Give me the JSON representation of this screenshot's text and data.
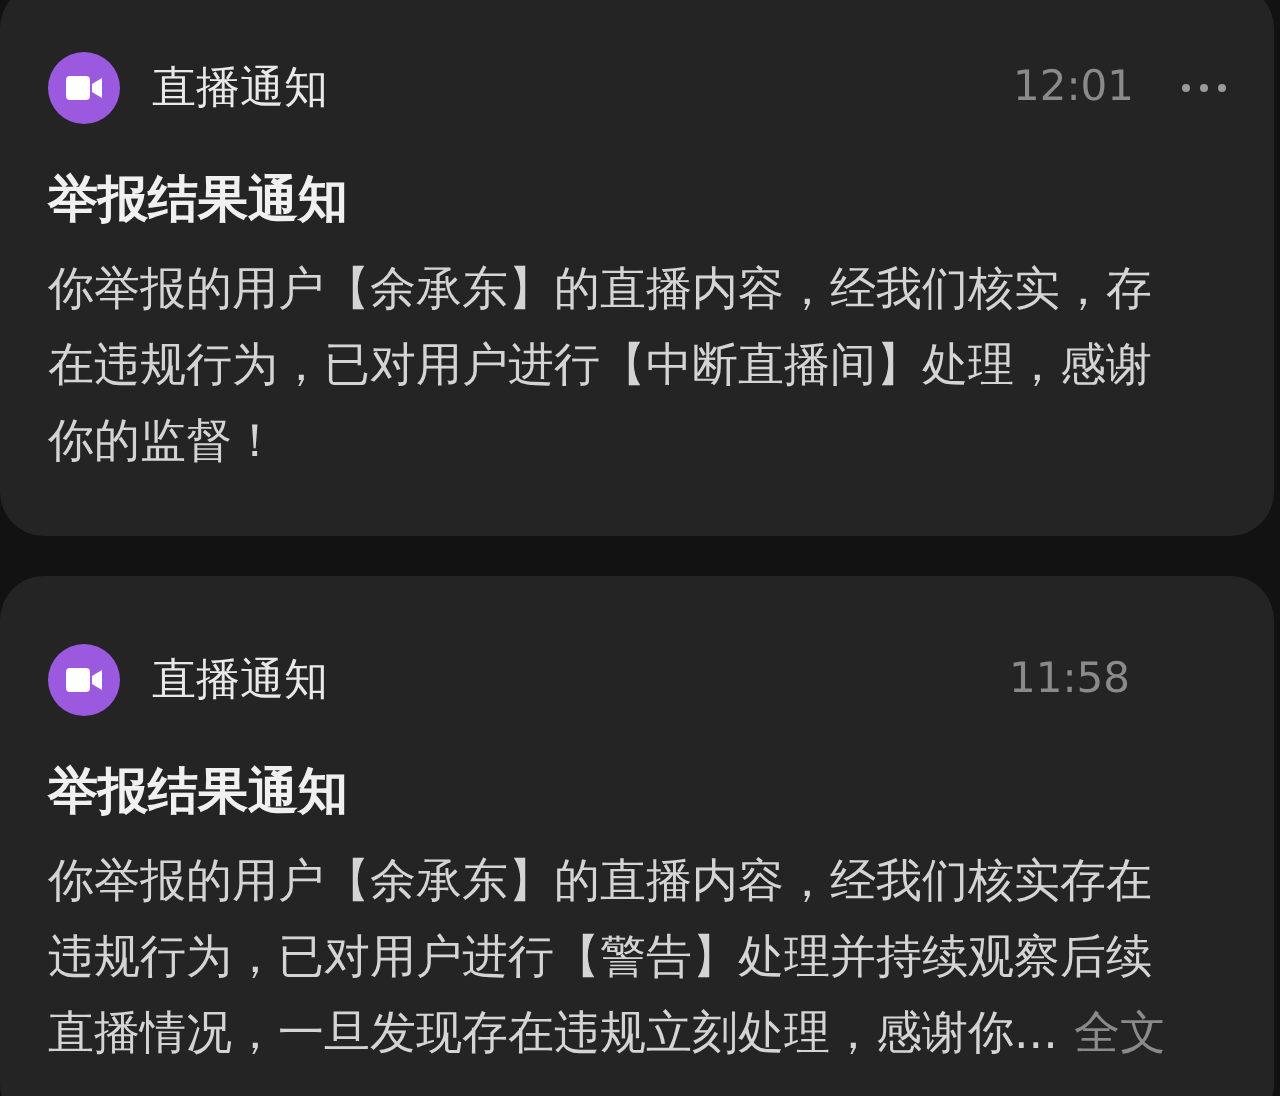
{
  "notifications": [
    {
      "app": "直播通知",
      "time": "12:01",
      "menu": true,
      "title": "举报结果通知",
      "body": "你举报的用户【余承东】的直播内容，经我们核实，存在违规行为，已对用户进行【中断直播间】处理，感谢你的监督！"
    },
    {
      "app": "直播通知",
      "time": "11:58",
      "menu": false,
      "title": "举报结果通知",
      "body": "你举报的用户【余承东】的直播内容，经我们核实存在违规行为，已对用户进行【警告】处理并持续观察后续直播情况，一旦发现存在违规立刻处理，感谢你...",
      "more": "全文"
    }
  ]
}
